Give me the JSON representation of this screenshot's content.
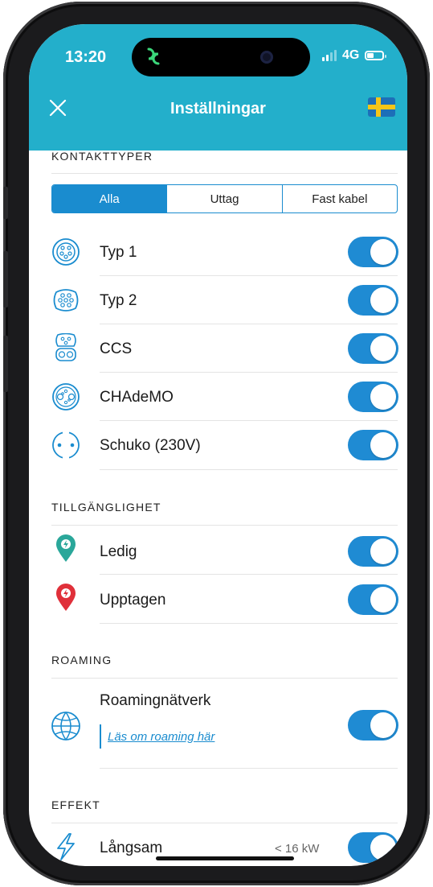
{
  "status": {
    "time": "13:20",
    "network": "4G"
  },
  "header": {
    "title": "Inställningar",
    "close_icon": "close-icon",
    "flag_icon": "sweden-flag-icon"
  },
  "colors": {
    "accent": "#23afcb",
    "toggle": "#1f8bd3",
    "segment": "#1a8ccf",
    "available": "#2aa79a",
    "occupied": "#e0303a"
  },
  "connector_types": {
    "heading": "KONTAKTTYPER",
    "segments": [
      {
        "label": "Alla",
        "active": true
      },
      {
        "label": "Uttag",
        "active": false
      },
      {
        "label": "Fast kabel",
        "active": false
      }
    ],
    "items": [
      {
        "label": "Typ 1",
        "icon": "type1-connector-icon",
        "enabled": true
      },
      {
        "label": "Typ 2",
        "icon": "type2-connector-icon",
        "enabled": true
      },
      {
        "label": "CCS",
        "icon": "ccs-connector-icon",
        "enabled": true
      },
      {
        "label": "CHAdeMO",
        "icon": "chademo-connector-icon",
        "enabled": true
      },
      {
        "label": "Schuko (230V)",
        "icon": "schuko-connector-icon",
        "enabled": true
      }
    ]
  },
  "availability": {
    "heading": "TILLGÄNGLIGHET",
    "items": [
      {
        "label": "Ledig",
        "icon": "available-pin-icon",
        "enabled": true
      },
      {
        "label": "Upptagen",
        "icon": "occupied-pin-icon",
        "enabled": true
      }
    ]
  },
  "roaming": {
    "heading": "ROAMING",
    "item": {
      "label": "Roamingnätverk",
      "icon": "globe-icon",
      "enabled": true
    },
    "link": "Läs om roaming här"
  },
  "power": {
    "heading": "EFFEKT",
    "items": [
      {
        "label": "Långsam",
        "value": "< 16 kW",
        "icon": "lightning-icon",
        "enabled": true
      }
    ]
  }
}
